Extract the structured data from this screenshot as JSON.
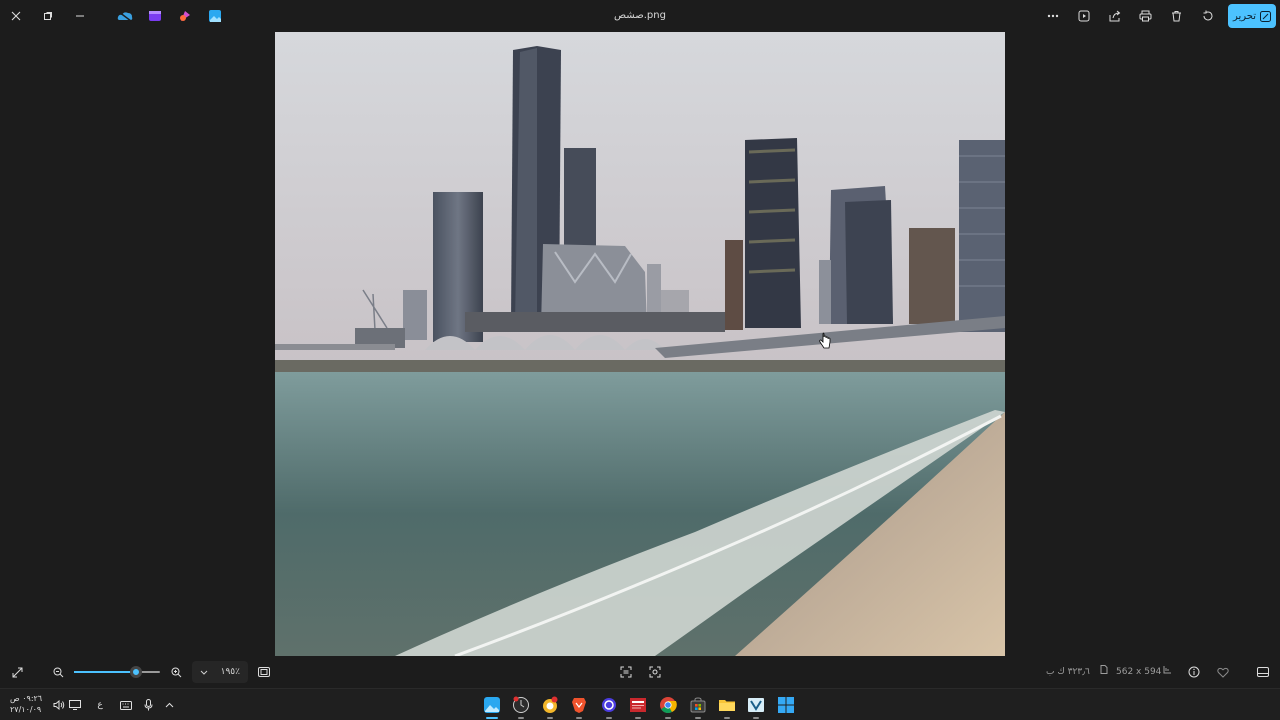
{
  "window": {
    "title": "صشص.png"
  },
  "titlebar": {
    "controls": [
      {
        "name": "close-icon",
        "glyph": "✕"
      },
      {
        "name": "restore-icon",
        "glyph": "⧉"
      },
      {
        "name": "minimize-icon",
        "glyph": "–"
      }
    ],
    "app_icons": [
      "onedrive-icon",
      "video-editor-icon",
      "designer-icon",
      "photos-app-icon"
    ]
  },
  "toolbar": {
    "edit_label": "تحرير",
    "actions": [
      "more-options-icon",
      "slideshow-icon",
      "share-icon",
      "print-icon",
      "delete-icon",
      "rotate-icon"
    ]
  },
  "bottom": {
    "zoom_percent": "١٩٥٪",
    "zoom_fraction": 0.72,
    "dimensions": "562 x 594",
    "file_size": "٣٢٣٫٦ ك ب"
  },
  "taskbar": {
    "time": "٠٩:٢٦ ص",
    "date": "٢٧/١٠/٠٩",
    "language": "ع",
    "apps": [
      {
        "name": "taskbar-photos-icon",
        "active": true
      },
      {
        "name": "taskbar-clock-app-icon",
        "active": false
      },
      {
        "name": "taskbar-chat-app-icon",
        "active": false
      },
      {
        "name": "taskbar-brave-icon",
        "active": false
      },
      {
        "name": "taskbar-cortana-icon",
        "active": false
      },
      {
        "name": "taskbar-news-icon",
        "active": false
      },
      {
        "name": "taskbar-chrome-icon",
        "active": false
      },
      {
        "name": "taskbar-store-icon",
        "active": false
      },
      {
        "name": "taskbar-file-explorer-icon",
        "active": false
      },
      {
        "name": "taskbar-vegas-icon",
        "active": false
      },
      {
        "name": "taskbar-start-icon",
        "active": false
      }
    ]
  },
  "colors": {
    "accent": "#4cc2ff",
    "background": "#1c1c1c"
  }
}
